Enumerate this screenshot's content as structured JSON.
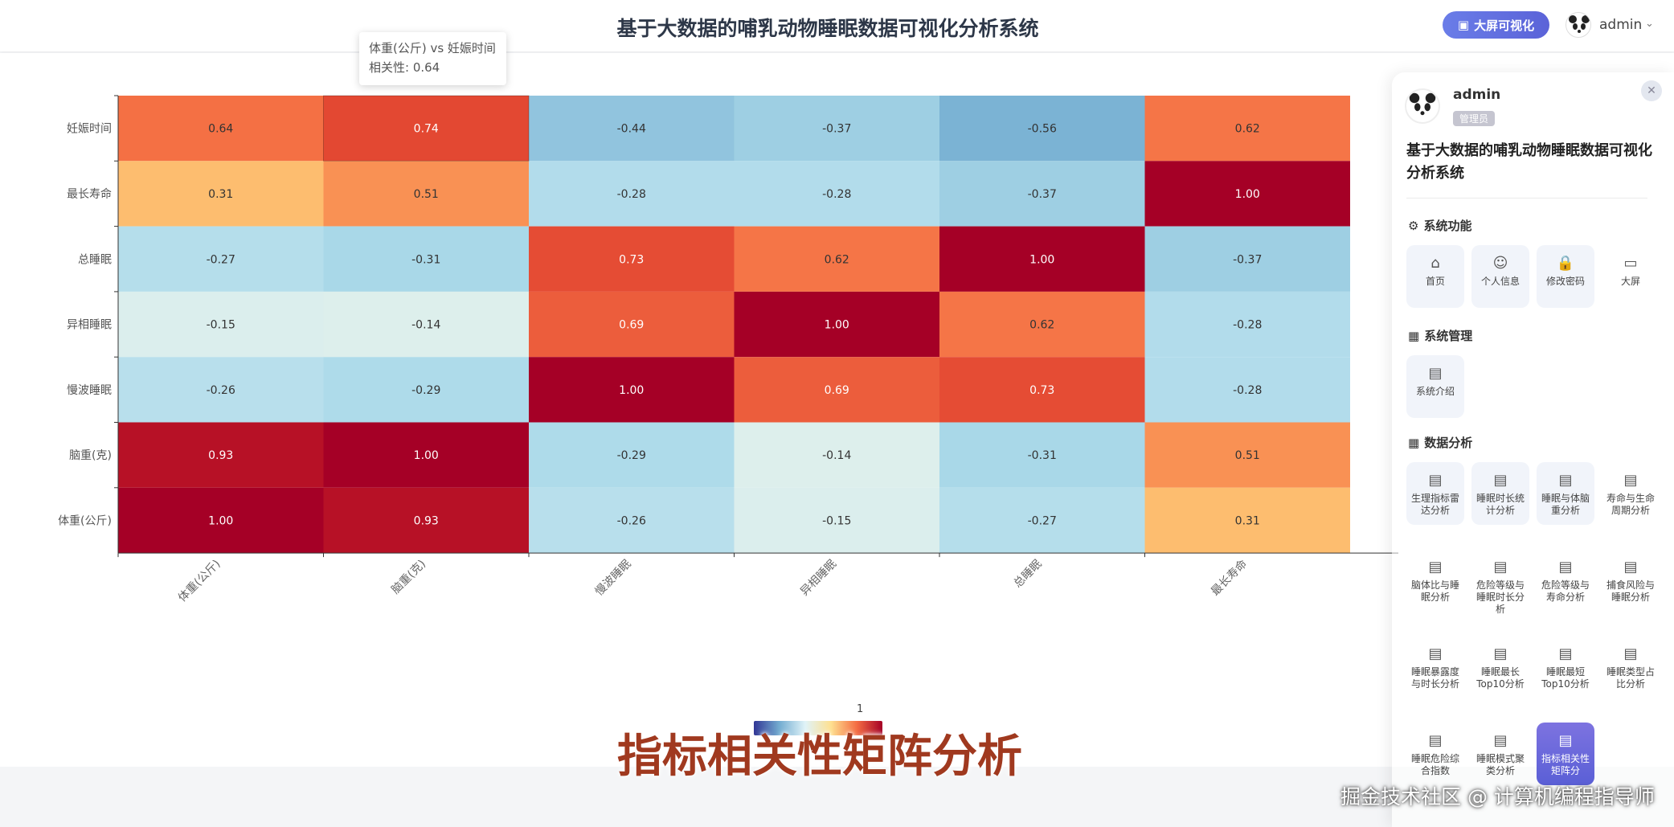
{
  "header": {
    "title": "基于大数据的哺乳动物睡眠数据可视化分析系统",
    "bigscreen_label": "大屏可视化",
    "user": "admin"
  },
  "tooltip": {
    "line1": "体重(公斤) vs 妊娠时间",
    "line2": "相关性: 0.64"
  },
  "visual_map_label": "1",
  "caption": "指标相关性矩阵分析",
  "watermark": "掘金技术社区 @ 计算机编程指导师",
  "colors": {
    "accent": "#5b63d8",
    "caption": "#a0391f"
  },
  "chart_data": {
    "type": "heatmap",
    "x_categories": [
      "体重(公斤)",
      "脑重(克)",
      "慢波睡眠",
      "异相睡眠",
      "总睡眠",
      "最长寿命"
    ],
    "y_categories": [
      "妊娠时间",
      "最长寿命",
      "总睡眠",
      "异相睡眠",
      "慢波睡眠",
      "脑重(克)",
      "体重(公斤)"
    ],
    "values": [
      [
        0.64,
        0.74,
        -0.44,
        -0.37,
        -0.56,
        0.62
      ],
      [
        0.31,
        0.51,
        -0.28,
        -0.28,
        -0.37,
        1.0
      ],
      [
        -0.27,
        -0.31,
        0.73,
        0.62,
        1.0,
        -0.37
      ],
      [
        -0.15,
        -0.14,
        0.69,
        1.0,
        0.62,
        -0.28
      ],
      [
        -0.26,
        -0.29,
        1.0,
        0.69,
        0.73,
        -0.28
      ],
      [
        0.93,
        1.0,
        -0.29,
        -0.14,
        -0.31,
        0.51
      ],
      [
        1.0,
        0.93,
        -0.26,
        -0.15,
        -0.27,
        0.31
      ]
    ],
    "color_range": [
      -1,
      1
    ]
  },
  "panel": {
    "user": "admin",
    "role": "管理员",
    "system_title": "基于大数据的哺乳动物睡眠数据可视化分析系统",
    "sections": [
      {
        "title": "系统功能",
        "icon": "gear-icon",
        "items": [
          {
            "label": "首页",
            "icon": "home-icon"
          },
          {
            "label": "个人信息",
            "icon": "user-icon"
          },
          {
            "label": "修改密码",
            "icon": "lock-icon"
          },
          {
            "label": "大屏",
            "icon": "screen-icon"
          }
        ]
      },
      {
        "title": "系统管理",
        "icon": "grid-icon",
        "items": [
          {
            "label": "系统介绍",
            "icon": "document-icon"
          }
        ]
      },
      {
        "title": "数据分析",
        "icon": "grid-icon",
        "items": [
          {
            "label": "生理指标雷达分析",
            "icon": "document-icon"
          },
          {
            "label": "睡眠时长统计分析",
            "icon": "document-icon"
          },
          {
            "label": "睡眠与体脑重分析",
            "icon": "document-icon"
          },
          {
            "label": "寿命与生命周期分析",
            "icon": "document-icon"
          },
          {
            "label": "脑体比与睡眠分析",
            "icon": "document-icon"
          },
          {
            "label": "危险等级与睡眠时长分析",
            "icon": "document-icon"
          },
          {
            "label": "危险等级与寿命分析",
            "icon": "document-icon"
          },
          {
            "label": "捕食风险与睡眠分析",
            "icon": "document-icon"
          },
          {
            "label": "睡眠暴露度与时长分析",
            "icon": "document-icon"
          },
          {
            "label": "睡眠最长Top10分析",
            "icon": "document-icon"
          },
          {
            "label": "睡眠最短Top10分析",
            "icon": "document-icon"
          },
          {
            "label": "睡眠类型占比分析",
            "icon": "document-icon"
          },
          {
            "label": "睡眠危险综合指数",
            "icon": "document-icon"
          },
          {
            "label": "睡眠模式聚类分析",
            "icon": "document-icon"
          },
          {
            "label": "指标相关性矩阵分",
            "icon": "document-icon"
          }
        ]
      }
    ]
  }
}
